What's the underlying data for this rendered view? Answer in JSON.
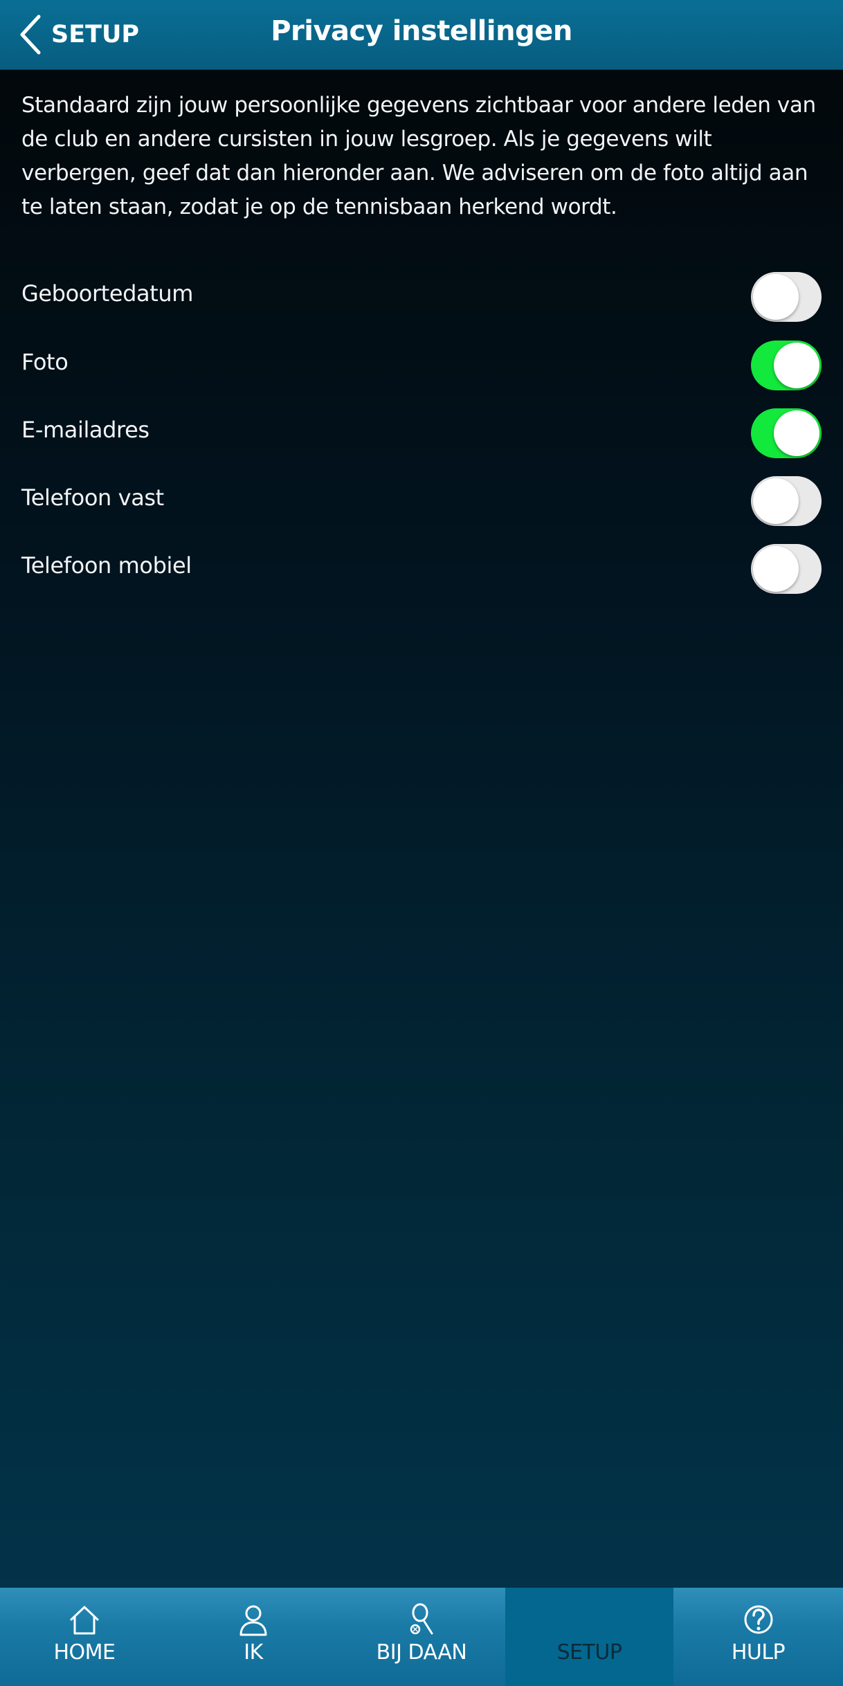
{
  "header": {
    "back_label": "SETUP",
    "title": "Privacy instellingen"
  },
  "intro": "Standaard zijn jouw persoonlijke gegevens zichtbaar voor andere leden van de club en andere cursisten in jouw lesgroep. Als je gegevens wilt verbergen, geef dat dan hieronder aan. We adviseren om de foto altijd aan te laten staan, zodat je op de tennisbaan herkend wordt.",
  "settings": [
    {
      "label": "Geboortedatum",
      "enabled": false
    },
    {
      "label": "Foto",
      "enabled": true
    },
    {
      "label": "E-mailadres",
      "enabled": true
    },
    {
      "label": "Telefoon vast",
      "enabled": false
    },
    {
      "label": "Telefoon mobiel",
      "enabled": false
    }
  ],
  "tabs": [
    {
      "label": "HOME",
      "icon": "home-icon"
    },
    {
      "label": "IK",
      "icon": "person-icon"
    },
    {
      "label": "BIJ DAAN",
      "icon": "tennis-racket-icon"
    },
    {
      "label": "SETUP",
      "icon": "",
      "active": true
    },
    {
      "label": "HULP",
      "icon": "help-circle-icon"
    }
  ],
  "colors": {
    "header": "#0a6f95",
    "toggle_on": "#13e83c",
    "toggle_off": "#e9e9ea",
    "tab_active": "#04678f"
  }
}
